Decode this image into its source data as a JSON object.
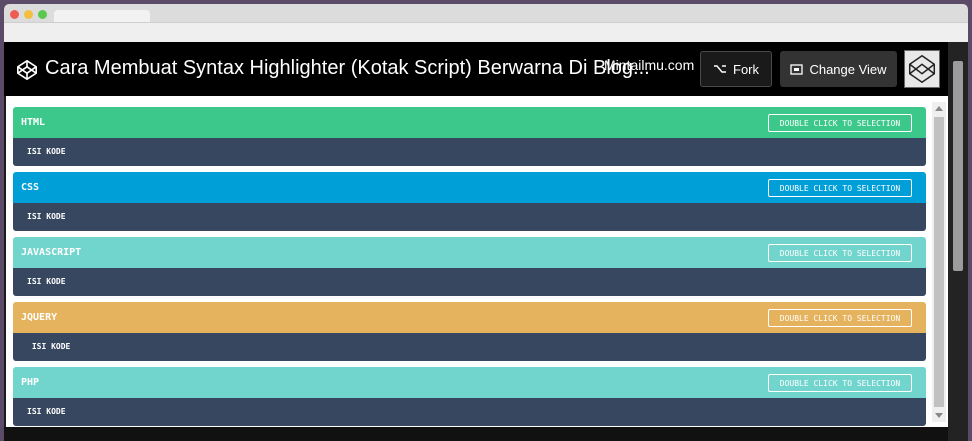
{
  "header": {
    "title": "Cara Membuat Syntax Highlighter (Kotak Script) Berwarna Di Blog...",
    "brand": "Mintailmu.com",
    "fork_label": "Fork",
    "change_view_label": "Change View"
  },
  "blocks": [
    {
      "lang": "HTML",
      "button": "DOUBLE CLICK TO SELECTION",
      "code": "ISI KODE",
      "color": "#3cc88a"
    },
    {
      "lang": "CSS",
      "button": "DOUBLE CLICK TO SELECTION",
      "code": "ISI KODE",
      "color": "#009fd7"
    },
    {
      "lang": "JAVASCRIPT",
      "button": "DOUBLE CLICK TO SELECTION",
      "code": "ISI KODE",
      "color": "#72d5cd"
    },
    {
      "lang": "JQUERY",
      "button": "DOUBLE CLICK TO SELECTION",
      "code": " ISI KODE",
      "color": "#e5b25d"
    },
    {
      "lang": "PHP",
      "button": "DOUBLE CLICK TO SELECTION",
      "code": "ISI KODE",
      "color": "#72d5cd"
    }
  ],
  "colors": {
    "code_bg": "#374760",
    "header_bg": "#000000"
  }
}
